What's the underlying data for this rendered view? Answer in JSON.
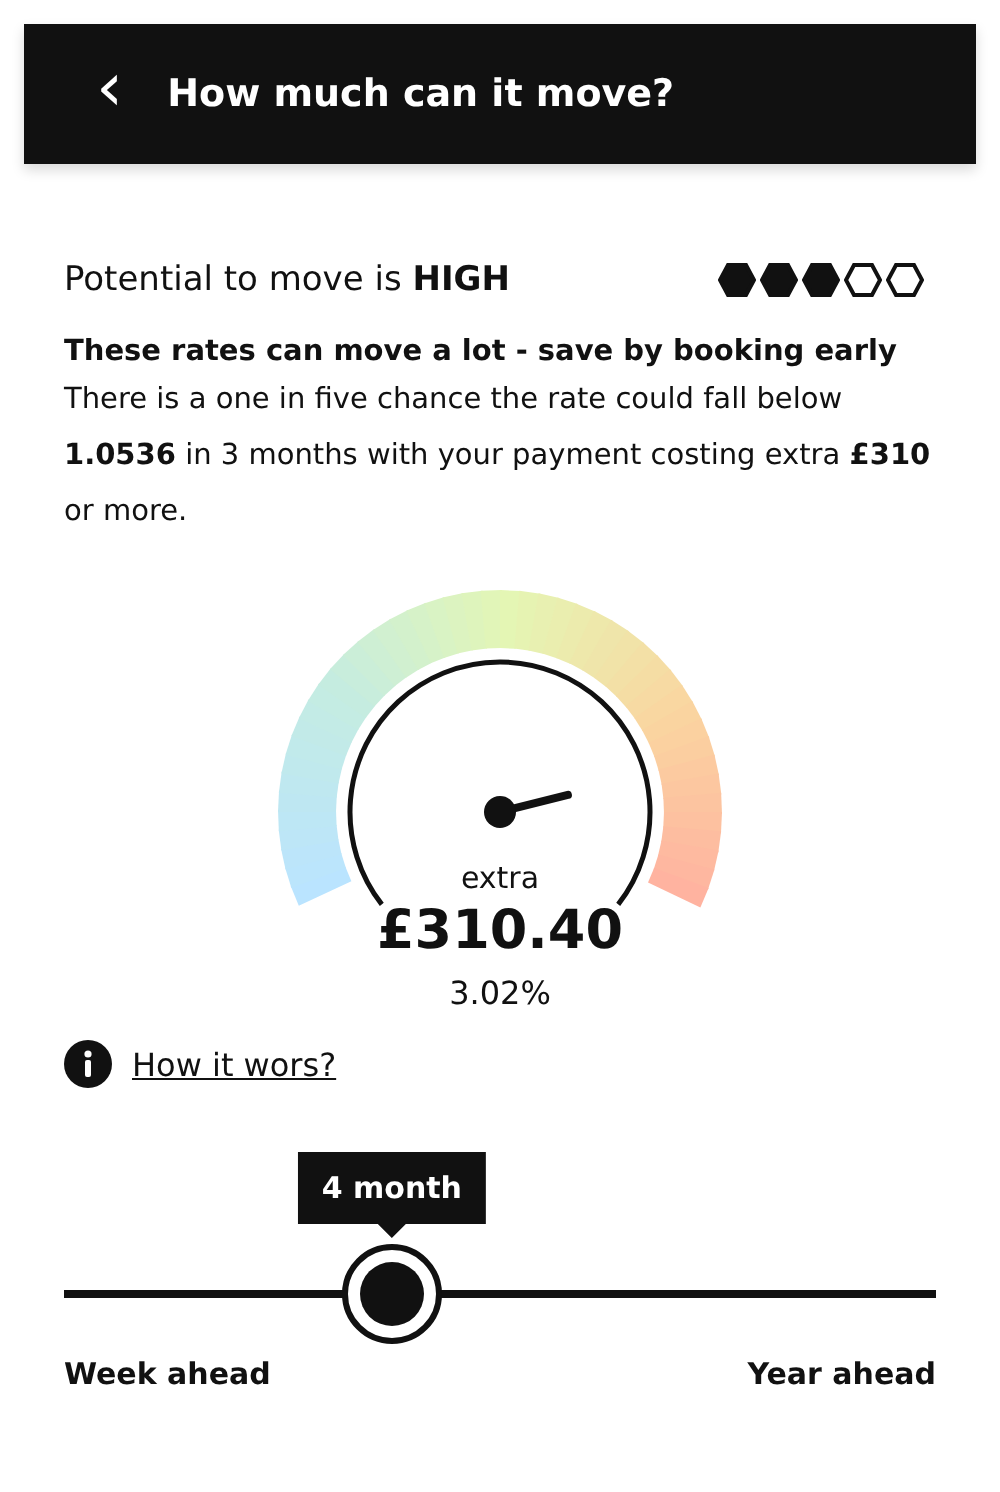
{
  "header": {
    "back_icon": "‹",
    "title": "How much can it move?"
  },
  "potential": {
    "label": "Potential to move is **HIGH**",
    "hexagons": [
      {
        "filled": true
      },
      {
        "filled": true
      },
      {
        "filled": true
      },
      {
        "filled": false
      },
      {
        "filled": false
      }
    ]
  },
  "headline": "These rates can move a lot - save by booking early",
  "description": "There is a one in five chance the rate could fall below **1.0536** in 3 months with your payment costing extra **£310** or more.",
  "gauge": {
    "caption": "extra",
    "amount": "£310.40",
    "percent": "3.02%"
  },
  "info_link": "How it wors?",
  "slider": {
    "level": 0.376,
    "tooltip": "4 month",
    "min_label": "Week ahead",
    "max_label": "Year ahead"
  }
}
